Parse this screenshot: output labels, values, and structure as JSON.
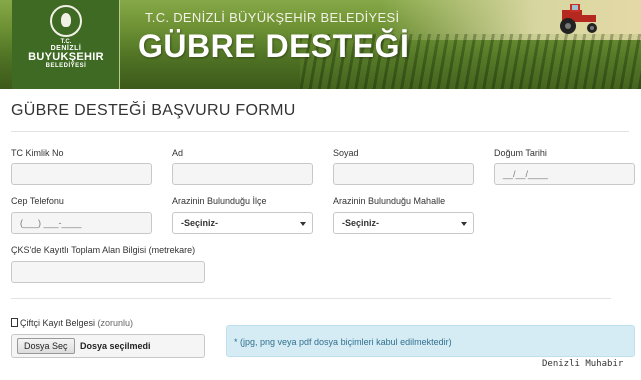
{
  "header": {
    "logo": {
      "tc": "T.C.",
      "city": "DENİZLİ",
      "name": "BUYUKŞEHIR",
      "subtitle": "BELEDİYESİ"
    },
    "institution": "T.C. DENİZLİ BÜYÜKŞEHİR BELEDİYESİ",
    "title": "GÜBRE DESTEĞİ"
  },
  "form": {
    "title": "GÜBRE DESTEĞİ BAŞVURU FORMU",
    "fields": {
      "tc_kimlik_no": {
        "label": "TC Kimlik No",
        "value": ""
      },
      "ad": {
        "label": "Ad",
        "value": ""
      },
      "soyad": {
        "label": "Soyad",
        "value": ""
      },
      "dogum_tarihi": {
        "label": "Doğum Tarihi",
        "mask": "__/__/____"
      },
      "cep_telefonu": {
        "label": "Cep Telefonu",
        "mask": "(___) ___-____"
      },
      "ilce": {
        "label": "Arazinin Bulunduğu İlçe",
        "selected": "-Seçiniz-"
      },
      "mahalle": {
        "label": "Arazinin Bulunduğu Mahalle",
        "selected": "-Seçiniz-"
      },
      "cks_alan": {
        "label": "ÇKS'de Kayıtlı Toplam Alan Bilgisi (metrekare)",
        "value": ""
      }
    },
    "upload": {
      "label": "Çiftçi Kayıt Belgesi",
      "optional": "(zorunlu)",
      "button": "Dosya Seç",
      "status": "Dosya seçilmedi",
      "note": "* (jpg, png veya pdf dosya biçimleri kabul edilmektedir)"
    }
  },
  "watermark": "Denizli Muhabir",
  "colors": {
    "banner_green": "#4f7224",
    "logo_bg": "#3f6a23",
    "info_bg": "#d6ecf5",
    "info_text": "#31708f"
  }
}
